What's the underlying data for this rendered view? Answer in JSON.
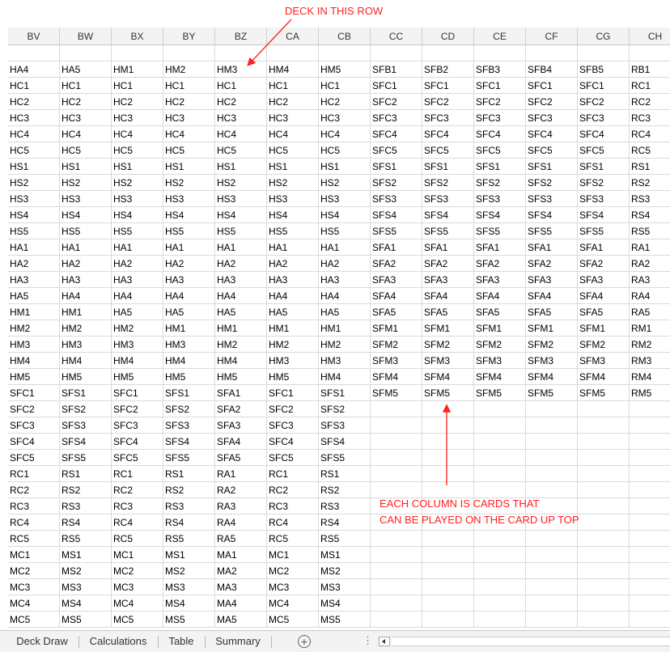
{
  "sheet": {
    "columns": [
      "BV",
      "BW",
      "BX",
      "BY",
      "BZ",
      "CA",
      "CB",
      "CC",
      "CD",
      "CE",
      "CF",
      "CG",
      "CH"
    ],
    "rows": [
      [
        "",
        "",
        "",
        "",
        "",
        "",
        "",
        "",
        "",
        "",
        "",
        "",
        ""
      ],
      [
        "HA4",
        "HA5",
        "HM1",
        "HM2",
        "HM3",
        "HM4",
        "HM5",
        "SFB1",
        "SFB2",
        "SFB3",
        "SFB4",
        "SFB5",
        "RB1"
      ],
      [
        "HC1",
        "HC1",
        "HC1",
        "HC1",
        "HC1",
        "HC1",
        "HC1",
        "SFC1",
        "SFC1",
        "SFC1",
        "SFC1",
        "SFC1",
        "RC1"
      ],
      [
        "HC2",
        "HC2",
        "HC2",
        "HC2",
        "HC2",
        "HC2",
        "HC2",
        "SFC2",
        "SFC2",
        "SFC2",
        "SFC2",
        "SFC2",
        "RC2"
      ],
      [
        "HC3",
        "HC3",
        "HC3",
        "HC3",
        "HC3",
        "HC3",
        "HC3",
        "SFC3",
        "SFC3",
        "SFC3",
        "SFC3",
        "SFC3",
        "RC3"
      ],
      [
        "HC4",
        "HC4",
        "HC4",
        "HC4",
        "HC4",
        "HC4",
        "HC4",
        "SFC4",
        "SFC4",
        "SFC4",
        "SFC4",
        "SFC4",
        "RC4"
      ],
      [
        "HC5",
        "HC5",
        "HC5",
        "HC5",
        "HC5",
        "HC5",
        "HC5",
        "SFC5",
        "SFC5",
        "SFC5",
        "SFC5",
        "SFC5",
        "RC5"
      ],
      [
        "HS1",
        "HS1",
        "HS1",
        "HS1",
        "HS1",
        "HS1",
        "HS1",
        "SFS1",
        "SFS1",
        "SFS1",
        "SFS1",
        "SFS1",
        "RS1"
      ],
      [
        "HS2",
        "HS2",
        "HS2",
        "HS2",
        "HS2",
        "HS2",
        "HS2",
        "SFS2",
        "SFS2",
        "SFS2",
        "SFS2",
        "SFS2",
        "RS2"
      ],
      [
        "HS3",
        "HS3",
        "HS3",
        "HS3",
        "HS3",
        "HS3",
        "HS3",
        "SFS3",
        "SFS3",
        "SFS3",
        "SFS3",
        "SFS3",
        "RS3"
      ],
      [
        "HS4",
        "HS4",
        "HS4",
        "HS4",
        "HS4",
        "HS4",
        "HS4",
        "SFS4",
        "SFS4",
        "SFS4",
        "SFS4",
        "SFS4",
        "RS4"
      ],
      [
        "HS5",
        "HS5",
        "HS5",
        "HS5",
        "HS5",
        "HS5",
        "HS5",
        "SFS5",
        "SFS5",
        "SFS5",
        "SFS5",
        "SFS5",
        "RS5"
      ],
      [
        "HA1",
        "HA1",
        "HA1",
        "HA1",
        "HA1",
        "HA1",
        "HA1",
        "SFA1",
        "SFA1",
        "SFA1",
        "SFA1",
        "SFA1",
        "RA1"
      ],
      [
        "HA2",
        "HA2",
        "HA2",
        "HA2",
        "HA2",
        "HA2",
        "HA2",
        "SFA2",
        "SFA2",
        "SFA2",
        "SFA2",
        "SFA2",
        "RA2"
      ],
      [
        "HA3",
        "HA3",
        "HA3",
        "HA3",
        "HA3",
        "HA3",
        "HA3",
        "SFA3",
        "SFA3",
        "SFA3",
        "SFA3",
        "SFA3",
        "RA3"
      ],
      [
        "HA5",
        "HA4",
        "HA4",
        "HA4",
        "HA4",
        "HA4",
        "HA4",
        "SFA4",
        "SFA4",
        "SFA4",
        "SFA4",
        "SFA4",
        "RA4"
      ],
      [
        "HM1",
        "HM1",
        "HA5",
        "HA5",
        "HA5",
        "HA5",
        "HA5",
        "SFA5",
        "SFA5",
        "SFA5",
        "SFA5",
        "SFA5",
        "RA5"
      ],
      [
        "HM2",
        "HM2",
        "HM2",
        "HM1",
        "HM1",
        "HM1",
        "HM1",
        "SFM1",
        "SFM1",
        "SFM1",
        "SFM1",
        "SFM1",
        "RM1"
      ],
      [
        "HM3",
        "HM3",
        "HM3",
        "HM3",
        "HM2",
        "HM2",
        "HM2",
        "SFM2",
        "SFM2",
        "SFM2",
        "SFM2",
        "SFM2",
        "RM2"
      ],
      [
        "HM4",
        "HM4",
        "HM4",
        "HM4",
        "HM4",
        "HM3",
        "HM3",
        "SFM3",
        "SFM3",
        "SFM3",
        "SFM3",
        "SFM3",
        "RM3"
      ],
      [
        "HM5",
        "HM5",
        "HM5",
        "HM5",
        "HM5",
        "HM5",
        "HM4",
        "SFM4",
        "SFM4",
        "SFM4",
        "SFM4",
        "SFM4",
        "RM4"
      ],
      [
        "SFC1",
        "SFS1",
        "SFC1",
        "SFS1",
        "SFA1",
        "SFC1",
        "SFS1",
        "SFM5",
        "SFM5",
        "SFM5",
        "SFM5",
        "SFM5",
        "RM5"
      ],
      [
        "SFC2",
        "SFS2",
        "SFC2",
        "SFS2",
        "SFA2",
        "SFC2",
        "SFS2",
        "",
        "",
        "",
        "",
        "",
        ""
      ],
      [
        "SFC3",
        "SFS3",
        "SFC3",
        "SFS3",
        "SFA3",
        "SFC3",
        "SFS3",
        "",
        "",
        "",
        "",
        "",
        ""
      ],
      [
        "SFC4",
        "SFS4",
        "SFC4",
        "SFS4",
        "SFA4",
        "SFC4",
        "SFS4",
        "",
        "",
        "",
        "",
        "",
        ""
      ],
      [
        "SFC5",
        "SFS5",
        "SFC5",
        "SFS5",
        "SFA5",
        "SFC5",
        "SFS5",
        "",
        "",
        "",
        "",
        "",
        ""
      ],
      [
        "RC1",
        "RS1",
        "RC1",
        "RS1",
        "RA1",
        "RC1",
        "RS1",
        "",
        "",
        "",
        "",
        "",
        ""
      ],
      [
        "RC2",
        "RS2",
        "RC2",
        "RS2",
        "RA2",
        "RC2",
        "RS2",
        "",
        "",
        "",
        "",
        "",
        ""
      ],
      [
        "RC3",
        "RS3",
        "RC3",
        "RS3",
        "RA3",
        "RC3",
        "RS3",
        "",
        "",
        "",
        "",
        "",
        ""
      ],
      [
        "RC4",
        "RS4",
        "RC4",
        "RS4",
        "RA4",
        "RC4",
        "RS4",
        "",
        "",
        "",
        "",
        "",
        ""
      ],
      [
        "RC5",
        "RS5",
        "RC5",
        "RS5",
        "RA5",
        "RC5",
        "RS5",
        "",
        "",
        "",
        "",
        "",
        ""
      ],
      [
        "MC1",
        "MS1",
        "MC1",
        "MS1",
        "MA1",
        "MC1",
        "MS1",
        "",
        "",
        "",
        "",
        "",
        ""
      ],
      [
        "MC2",
        "MS2",
        "MC2",
        "MS2",
        "MA2",
        "MC2",
        "MS2",
        "",
        "",
        "",
        "",
        "",
        ""
      ],
      [
        "MC3",
        "MS3",
        "MC3",
        "MS3",
        "MA3",
        "MC3",
        "MS3",
        "",
        "",
        "",
        "",
        "",
        ""
      ],
      [
        "MC4",
        "MS4",
        "MC4",
        "MS4",
        "MA4",
        "MC4",
        "MS4",
        "",
        "",
        "",
        "",
        "",
        ""
      ],
      [
        "MC5",
        "MS5",
        "MC5",
        "MS5",
        "MA5",
        "MC5",
        "MS5",
        "",
        "",
        "",
        "",
        "",
        ""
      ]
    ]
  },
  "annotations": {
    "deck_label": "DECK IN THIS ROW",
    "column_line1": "EACH COLUMN IS CARDS THAT",
    "column_line2": "CAN BE PLAYED ON THE CARD UP TOP",
    "color": "#ff2020"
  },
  "tabs": [
    "Deck Draw",
    "Calculations",
    "Table",
    "Summary"
  ],
  "tabbar": {
    "add_icon": "plus-circle-icon",
    "more_icon": "ellipsis-icon",
    "scroll_icon": "scroll-left-icon"
  }
}
